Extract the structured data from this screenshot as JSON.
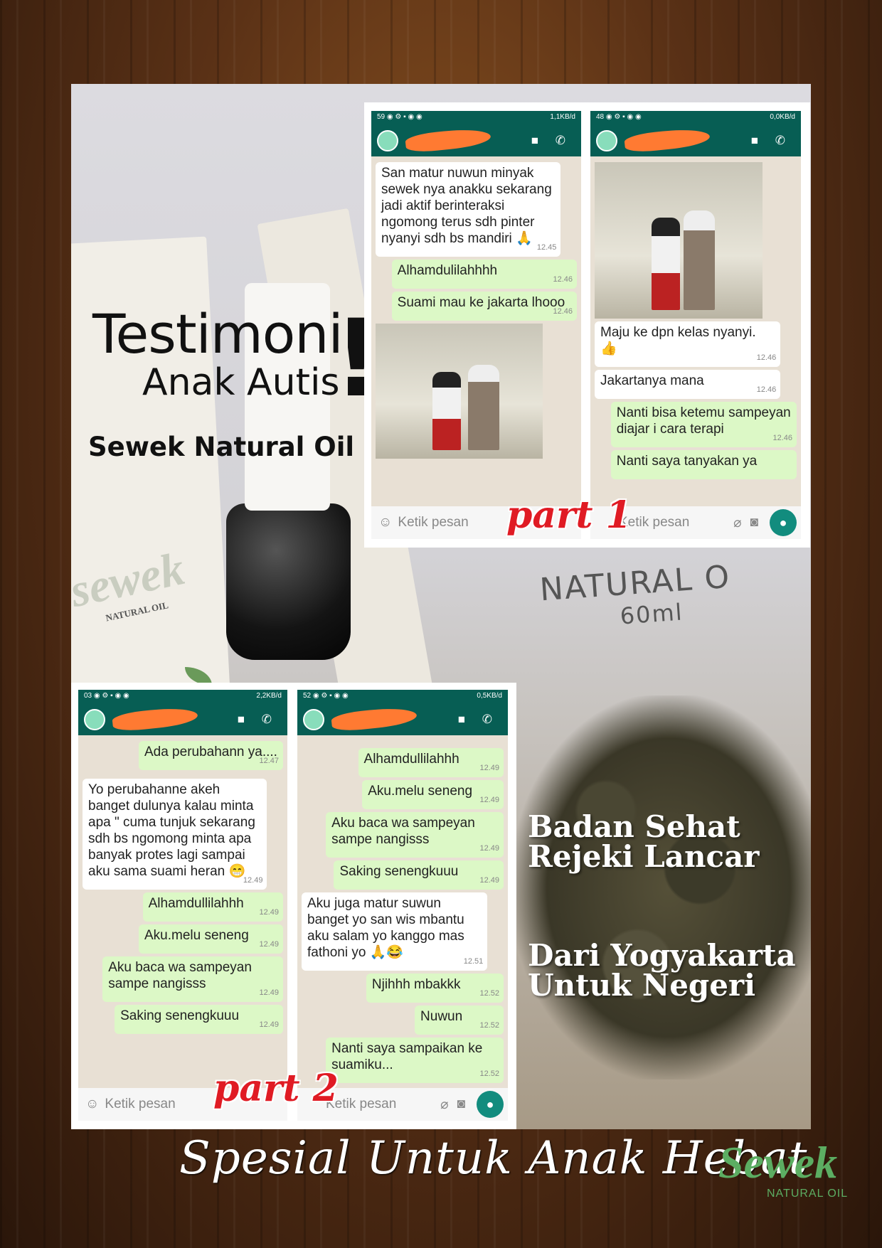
{
  "title": {
    "line1": "Testimoni",
    "line2": "Anak Autis",
    "mark": "!",
    "product": "Sewek Natural Oil"
  },
  "background": {
    "box_brand": "sewek",
    "box_sub": "NATURAL OIL",
    "label": "NATURAL O",
    "volume": "60ml"
  },
  "part1": {
    "badge": "part 1",
    "left": {
      "status": "1,1KB/d",
      "messages": [
        {
          "dir": "in",
          "text": "San matur nuwun minyak sewek nya anakku sekarang jadi aktif berinteraksi ngomong terus sdh pinter nyanyi sdh bs mandiri 🙏",
          "time": "12.45"
        },
        {
          "dir": "out",
          "text": "Alhamdulilahhhh",
          "time": "12.46"
        },
        {
          "dir": "out",
          "text": "Suami mau ke jakarta lhooo",
          "time": "12.46"
        }
      ],
      "input": "Ketik pesan"
    },
    "right": {
      "status": "0,0KB/d",
      "messages": [
        {
          "dir": "in",
          "text": "Maju ke dpn kelas nyanyi. 👍",
          "time": "12.46"
        },
        {
          "dir": "in",
          "text": "Jakartanya mana",
          "time": "12.46"
        },
        {
          "dir": "out",
          "text": "Nanti bisa ketemu sampeyan diajar i cara terapi",
          "time": "12.46"
        },
        {
          "dir": "out",
          "text": "Nanti saya tanyakan ya",
          "time": ""
        }
      ],
      "input": "Ketik pesan"
    }
  },
  "part2": {
    "badge": "part 2",
    "left": {
      "status": "2,2KB/d",
      "messages": [
        {
          "dir": "out",
          "text": "Ada perubahann ya....",
          "time": "12.47"
        },
        {
          "dir": "in",
          "text": "Yo perubahanne akeh banget dulunya kalau minta apa \" cuma tunjuk sekarang sdh bs ngomong minta apa banyak protes lagi sampai aku sama suami heran 😁",
          "time": "12.49"
        },
        {
          "dir": "out",
          "text": "Alhamdullilahhh",
          "time": "12.49"
        },
        {
          "dir": "out",
          "text": "Aku.melu seneng",
          "time": "12.49"
        },
        {
          "dir": "out",
          "text": "Aku baca wa sampeyan sampe nangisss",
          "time": "12.49"
        },
        {
          "dir": "out",
          "text": "Saking senengkuuu",
          "time": "12.49"
        }
      ],
      "input": "Ketik pesan"
    },
    "right": {
      "status": "0,5KB/d",
      "messages": [
        {
          "dir": "out",
          "text": "Alhamdullilahhh",
          "time": "12.49"
        },
        {
          "dir": "out",
          "text": "Aku.melu seneng",
          "time": "12.49"
        },
        {
          "dir": "out",
          "text": "Aku baca wa sampeyan sampe nangisss",
          "time": "12.49"
        },
        {
          "dir": "out",
          "text": "Saking senengkuuu",
          "time": "12.49"
        },
        {
          "dir": "in",
          "text": "Aku juga matur suwun banget yo san wis mbantu aku salam yo kanggo mas fathoni yo 🙏😂",
          "time": "12.51"
        },
        {
          "dir": "out",
          "text": "Njihhh mbakkk",
          "time": "12.52"
        },
        {
          "dir": "out",
          "text": "Nuwun",
          "time": "12.52"
        },
        {
          "dir": "out",
          "text": "Nanti saya sampaikan ke suamiku...",
          "time": "12.52"
        }
      ],
      "input": "Ketik pesan"
    }
  },
  "slogans": {
    "s1a": "Badan Sehat",
    "s1b": "Rejeki Lancar",
    "s2a": "Dari Yogyakarta",
    "s2b": "Untuk Negeri"
  },
  "footer": {
    "tagline": "Spesial Untuk Anak Hebat",
    "logo_word": "Sewek",
    "logo_sub": "NATURAL OIL"
  },
  "colors": {
    "whatsapp_header": "#075e54",
    "bubble_out": "#dcf8c6",
    "accent_red": "#e01b24",
    "logo_green": "#5cad62"
  }
}
